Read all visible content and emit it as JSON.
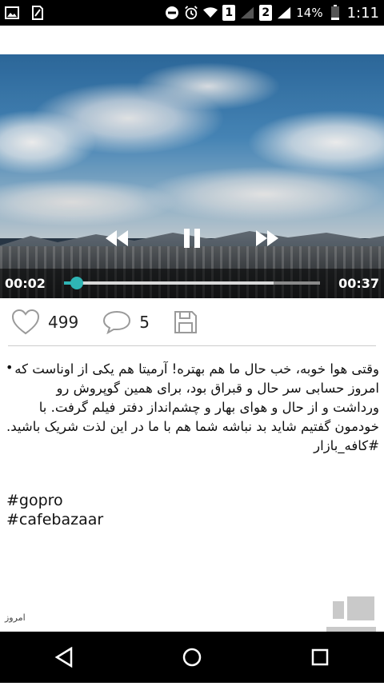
{
  "status_bar": {
    "sim1": "1",
    "sim2": "2",
    "battery": "14%",
    "time": "1:11",
    "icons": [
      "gallery-icon",
      "sim-manager-icon",
      "do-not-disturb-icon",
      "alarm-icon",
      "wifi-icon",
      "signal-icon",
      "battery-icon"
    ]
  },
  "player": {
    "elapsed": "00:02",
    "total": "00:37",
    "progress_fraction": 0.05,
    "buffered_fraction": 0.82,
    "accent_color": "#2fb5b5"
  },
  "actions": {
    "likes": "499",
    "comments": "5"
  },
  "post": {
    "bullet": "•",
    "caption": "وقتی هوا خوبه، خب حال ما هم بهتره! آرمیتا هم یکی از اوناست که امروز حسابی سر حال و قبراق بود، برای همین گوپروش رو ورداشت و از حال و هوای بهار و چشم‌انداز دفتر فیلم گرفت. با خودمون گفتیم شاید بد نباشه شما هم با ما در این لذت شریک باشید.",
    "hashtag_fa": "#کافه_بازار",
    "hashtag_1": "#gopro",
    "hashtag_2": "#cafebazaar",
    "date": "امروز"
  }
}
